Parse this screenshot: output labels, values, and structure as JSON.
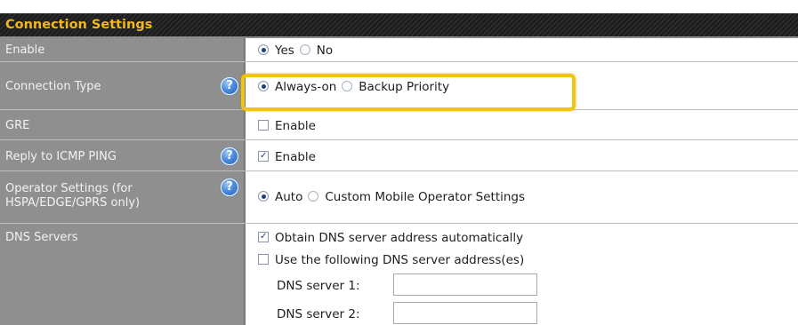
{
  "section": {
    "title": "Connection Settings"
  },
  "rows": {
    "enable": {
      "label": "Enable",
      "options": [
        "Yes",
        "No"
      ],
      "selected": "Yes"
    },
    "connection_type": {
      "label": "Connection Type",
      "options": [
        "Always-on",
        "Backup Priority"
      ],
      "selected": "Always-on"
    },
    "gre": {
      "label": "GRE",
      "checkbox_label": "Enable",
      "checked": false
    },
    "reply_icmp": {
      "label": "Reply to ICMP PING",
      "checkbox_label": "Enable",
      "checked": true
    },
    "operator": {
      "label_line1": "Operator Settings (for",
      "label_line2": "HSPA/EDGE/GPRS only)",
      "options": [
        "Auto",
        "Custom Mobile Operator Settings"
      ],
      "selected": "Auto"
    },
    "dns": {
      "label": "DNS Servers",
      "auto_label": "Obtain DNS server address automatically",
      "auto_checked": true,
      "manual_label": "Use the following DNS server address(es)",
      "manual_checked": false,
      "server1_label": "DNS server 1:",
      "server1_value": "",
      "server2_label": "DNS server 2:",
      "server2_value": ""
    }
  },
  "help_icon_glyph": "?",
  "colors": {
    "header_text": "#f3b81d",
    "label_bg": "#8f8f8f",
    "highlight": "#f2c40c"
  }
}
